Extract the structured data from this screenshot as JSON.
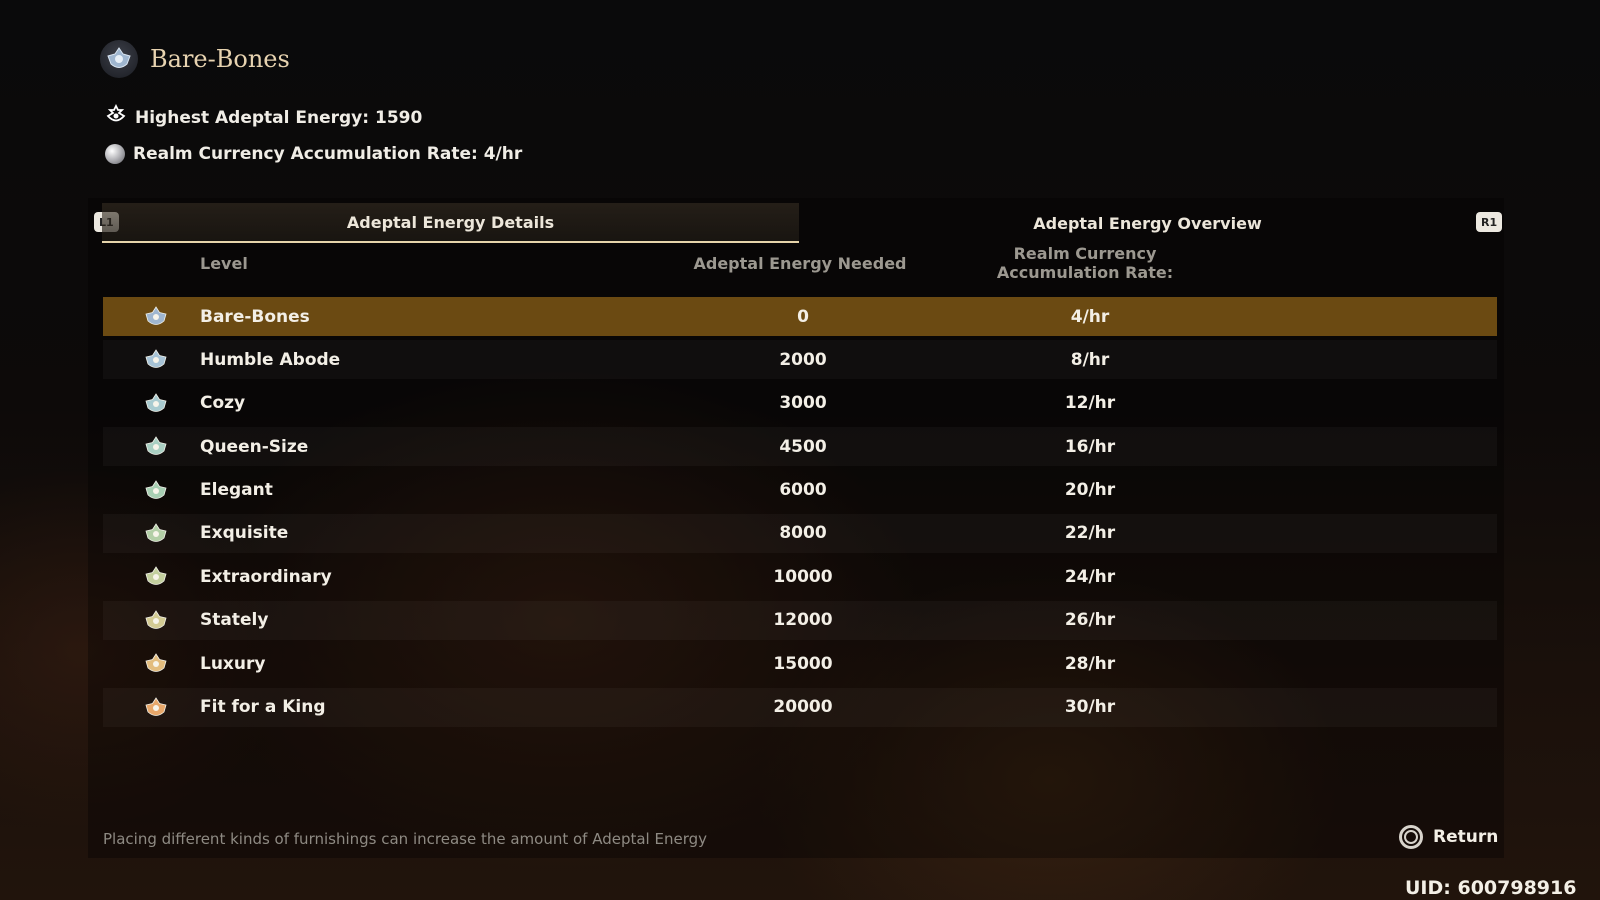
{
  "header": {
    "title": "Bare-Bones",
    "highest_energy": "Highest Adeptal Energy: 1590",
    "currency_rate": "Realm Currency Accumulation Rate: 4/hr"
  },
  "tabs": {
    "left_button": "L1",
    "right_button": "R1",
    "details_label": "Adeptal Energy Details",
    "overview_label": "Adeptal Energy Overview"
  },
  "columns": {
    "level": "Level",
    "needed": "Adeptal Energy Needed",
    "rate": "Realm Currency Accumulation Rate:"
  },
  "rows": [
    {
      "level": "Bare-Bones",
      "needed": "0",
      "rate": "4/hr",
      "color": "#9fb6cf",
      "selected": true
    },
    {
      "level": "Humble Abode",
      "needed": "2000",
      "rate": "8/hr",
      "color": "#a7c3d6"
    },
    {
      "level": "Cozy",
      "needed": "3000",
      "rate": "12/hr",
      "color": "#a9cbd0"
    },
    {
      "level": "Queen-Size",
      "needed": "4500",
      "rate": "16/hr",
      "color": "#a9cfc2"
    },
    {
      "level": "Elegant",
      "needed": "6000",
      "rate": "20/hr",
      "color": "#a8cfb3"
    },
    {
      "level": "Exquisite",
      "needed": "8000",
      "rate": "22/hr",
      "color": "#b3cfa7"
    },
    {
      "level": "Extraordinary",
      "needed": "10000",
      "rate": "24/hr",
      "color": "#c3cf9e"
    },
    {
      "level": "Stately",
      "needed": "12000",
      "rate": "26/hr",
      "color": "#d3cb94"
    },
    {
      "level": "Luxury",
      "needed": "15000",
      "rate": "28/hr",
      "color": "#e3bd7e"
    },
    {
      "level": "Fit for a King",
      "needed": "20000",
      "rate": "30/hr",
      "color": "#e7a76a"
    }
  ],
  "footer": {
    "note": "Placing different kinds of furnishings can increase the amount of Adeptal Energy",
    "return_label": "Return",
    "uid": "UID: 600798916"
  },
  "colors": {
    "selected_row": "#6b4a12",
    "tab_underline": "#e6d4aa"
  }
}
